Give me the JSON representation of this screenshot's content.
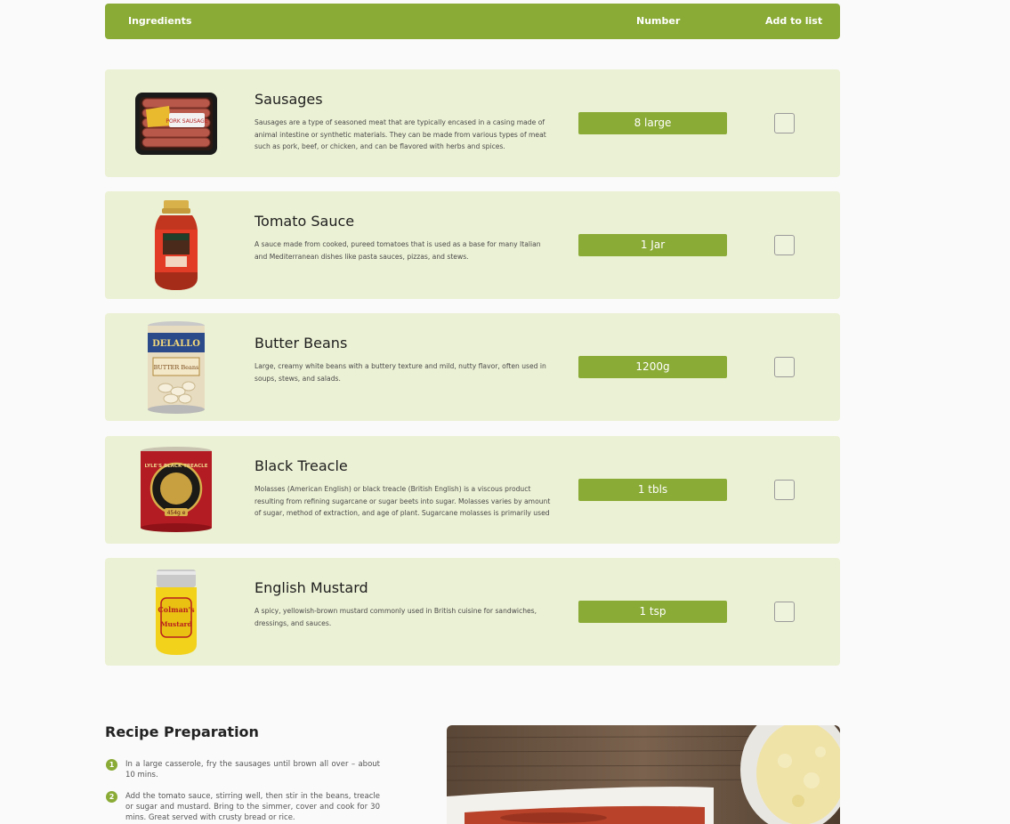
{
  "table_header": {
    "ingredients": "Ingredients",
    "number": "Number",
    "add_to_list": "Add to list"
  },
  "ingredients": [
    {
      "name": "Sausages",
      "description": "Sausages are a type of seasoned meat that are typically encased in a casing made of animal intestine or synthetic materials. They can be made from various types of meat such as pork, beef, or chicken, and can be flavored with herbs and spices.",
      "quantity": "8 large",
      "image_icon": "sausage-pack-icon",
      "image_label": "PORK SAUSAGE"
    },
    {
      "name": "Tomato Sauce",
      "description": "A sauce made from cooked, pureed tomatoes that is used as a base for many Italian and Mediterranean dishes like pasta sauces, pizzas, and stews.",
      "quantity": "1 Jar",
      "image_icon": "sauce-jar-icon"
    },
    {
      "name": "Butter Beans",
      "description": "Large, creamy white beans with a buttery texture and mild, nutty flavor, often used in soups, stews, and salads.",
      "quantity": "1200g",
      "image_icon": "bean-can-icon",
      "image_label": "DELALLO",
      "image_sublabel": "BUTTER Beans"
    },
    {
      "name": "Black Treacle",
      "description": "Molasses (American English) or black treacle (British English) is a viscous product resulting from refining sugarcane or sugar beets into sugar. Molasses varies by amount of sugar, method of extraction, and age of plant. Sugarcane molasses is primarily used",
      "quantity": "1 tbls",
      "image_icon": "treacle-tin-icon",
      "image_label": "LYLE'S BLACK TREACLE",
      "image_sublabel": "454g e"
    },
    {
      "name": "English Mustard",
      "description": "A spicy, yellowish-brown mustard commonly used in British cuisine for sandwiches, dressings, and sauces.",
      "quantity": "1 tsp",
      "image_icon": "mustard-jar-icon",
      "image_label": "Colman's",
      "image_sublabel": "Mustard"
    }
  ],
  "preparation": {
    "title": "Recipe Preparation",
    "steps": [
      {
        "num": "1",
        "text": "In a large casserole, fry the sausages until brown all over – about 10 mins."
      },
      {
        "num": "2",
        "text": "Add the tomato sauce, stirring well, then stir in the beans, treacle or sugar and mustard. Bring to the simmer, cover and cook for 30 mins. Great served with crusty bread or rice."
      }
    ]
  },
  "colors": {
    "accent": "#8aab36",
    "row_background": "#ebf1d4",
    "page_background": "#fafafa"
  }
}
